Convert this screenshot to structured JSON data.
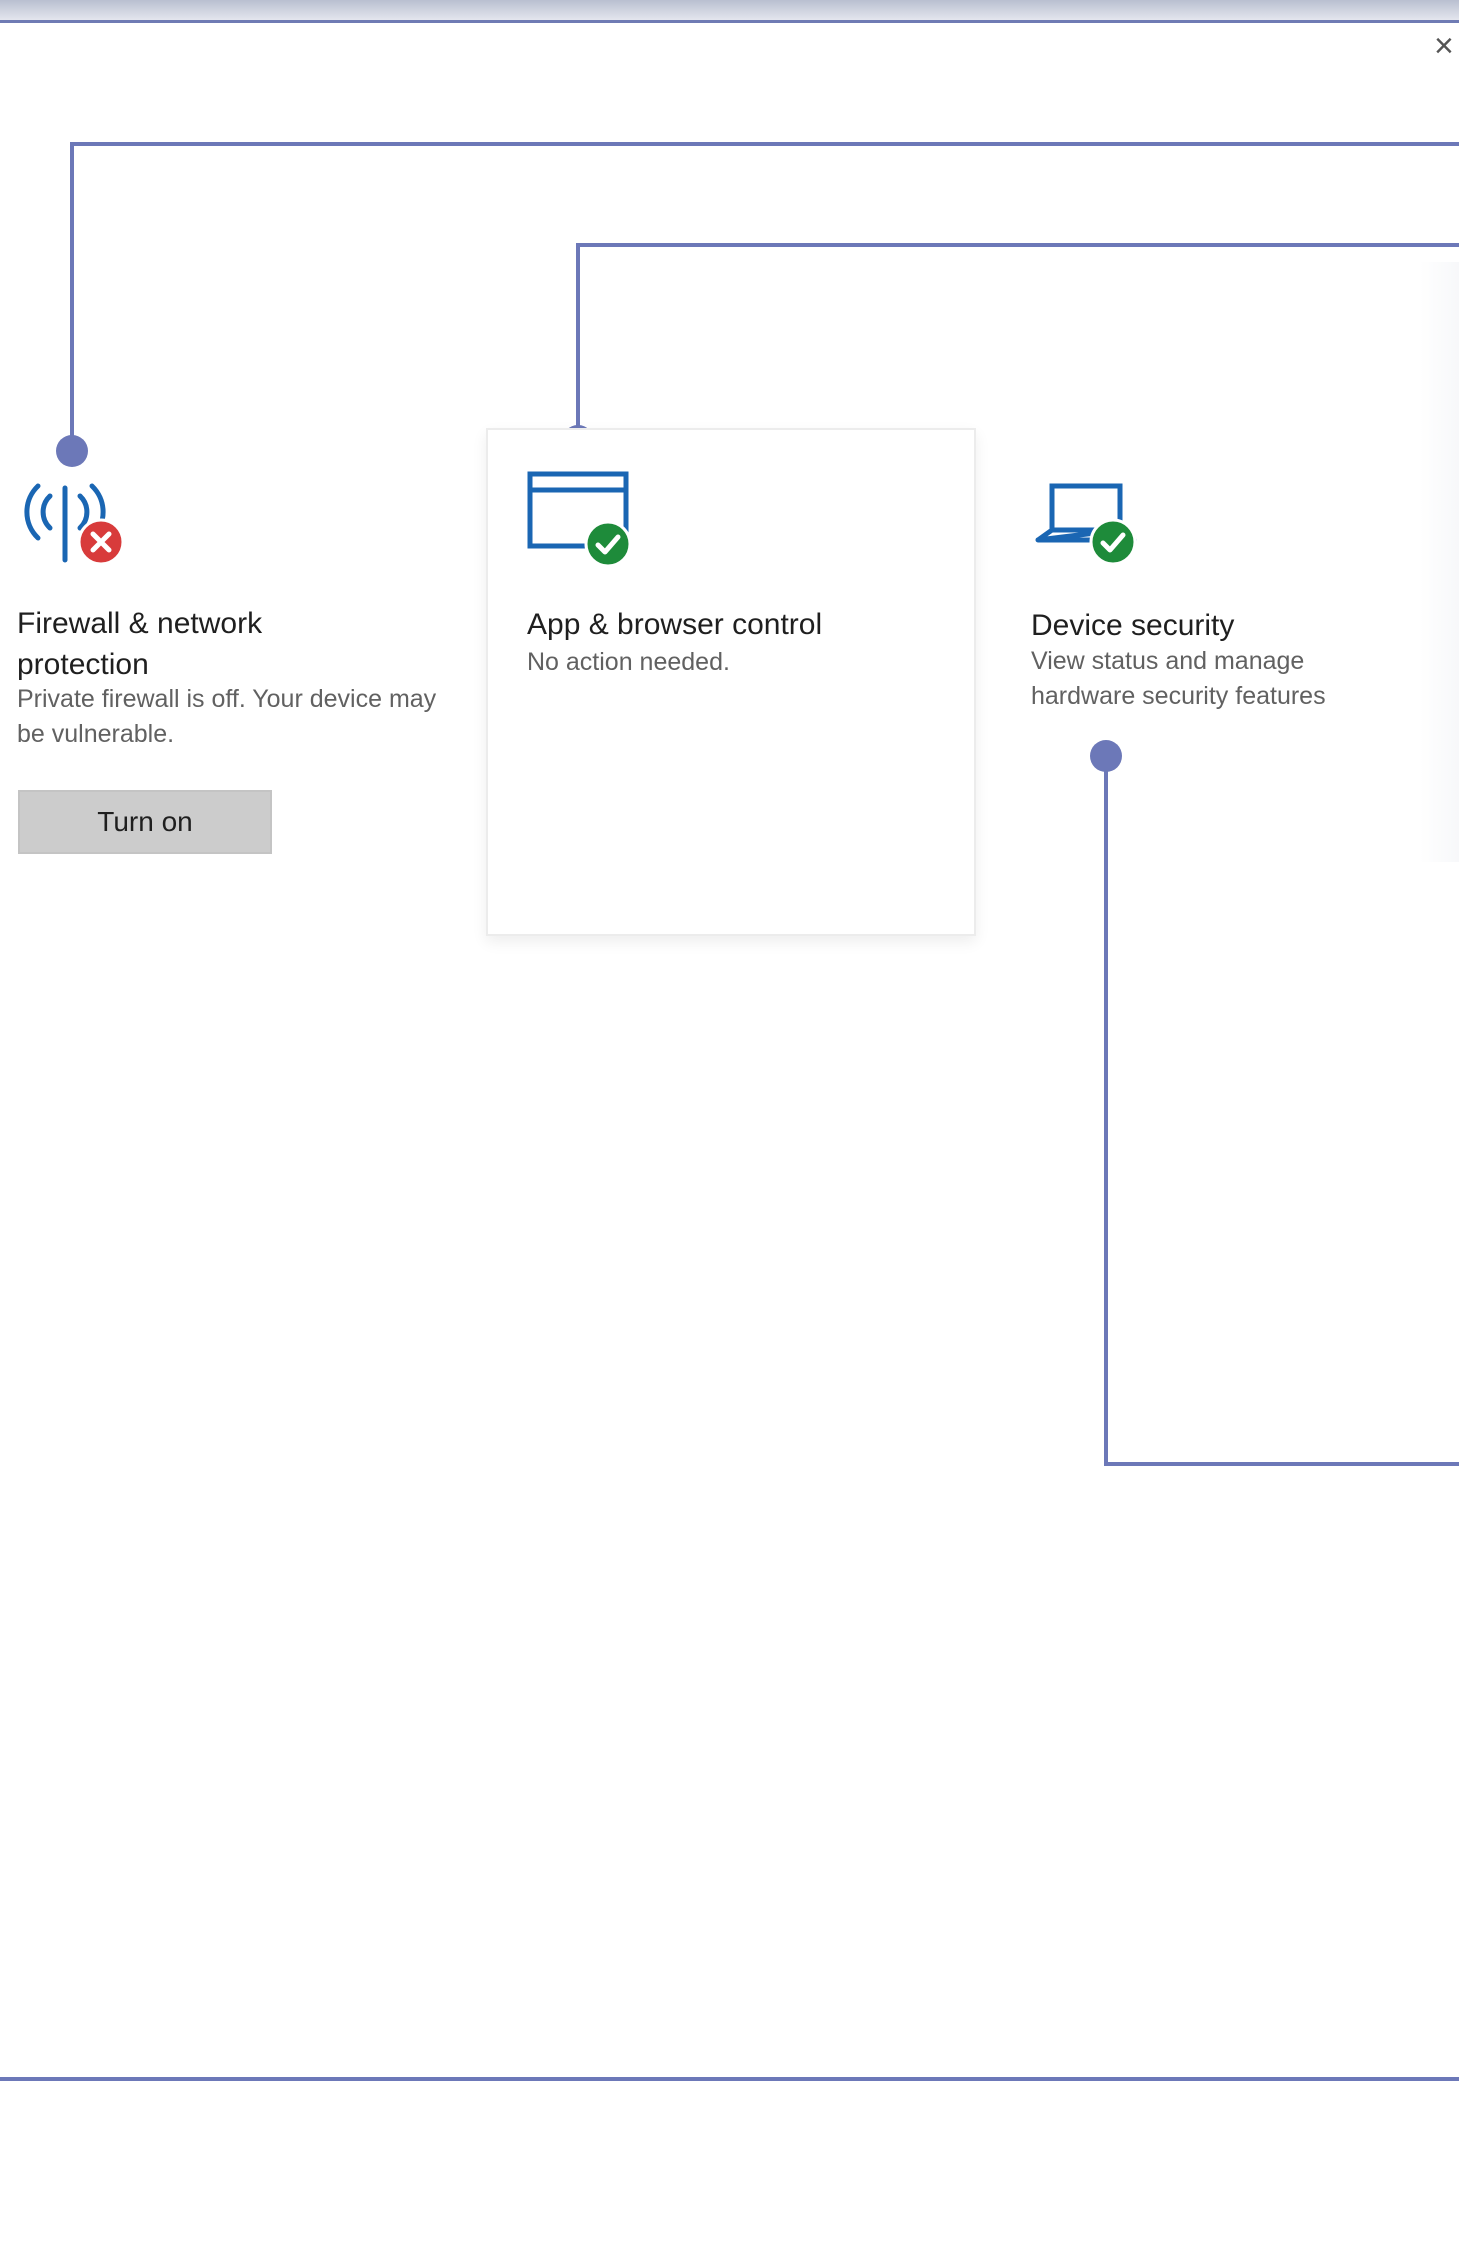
{
  "window": {
    "close_glyph": "×"
  },
  "tiles": [
    {
      "title": "Firewall & network protection",
      "description": "Private firewall is off. Your device may be vulnerable.",
      "button": "Turn on",
      "icon": "wifi-signal-icon",
      "status_icon": "error-x-icon",
      "status_color": "#d83b3b"
    },
    {
      "title": "App & browser control",
      "description": "No action needed.",
      "icon": "browser-window-icon",
      "status_icon": "checkmark-icon",
      "status_color": "#1e8b3a"
    },
    {
      "title": "Device security",
      "description": "View status and manage hardware security features",
      "icon": "laptop-icon",
      "status_icon": "checkmark-icon",
      "status_color": "#1e8b3a"
    }
  ],
  "colors": {
    "icon_blue": "#1a66b3",
    "connector": "#6c78b8"
  }
}
